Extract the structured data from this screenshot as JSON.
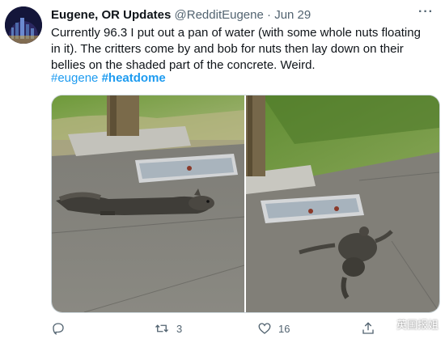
{
  "tweet": {
    "author_name": "Eugene, OR Updates",
    "handle": "@RedditEugene",
    "separator": "·",
    "date": "Jun 29",
    "text": "Currently 96.3 I put out a pan of water (with some whole nuts floating in it). The critters come by and bob for nuts then lay down on their bellies on the shaded part of the concrete. Weird.",
    "hashtags": [
      "#eugene",
      "#heatdome"
    ]
  },
  "actions": {
    "reply_count": "",
    "retweet_count": "3",
    "like_count": "16",
    "icons": [
      "reply-icon",
      "retweet-icon",
      "like-icon",
      "share-icon"
    ]
  },
  "media": {
    "photos": [
      "squirrel-photo-left",
      "squirrel-photo-right"
    ]
  },
  "watermark": {
    "text": "英国报姐"
  },
  "colors": {
    "link": "#1d9bf0",
    "secondary_text": "#536471",
    "primary_text": "#0f1419"
  }
}
